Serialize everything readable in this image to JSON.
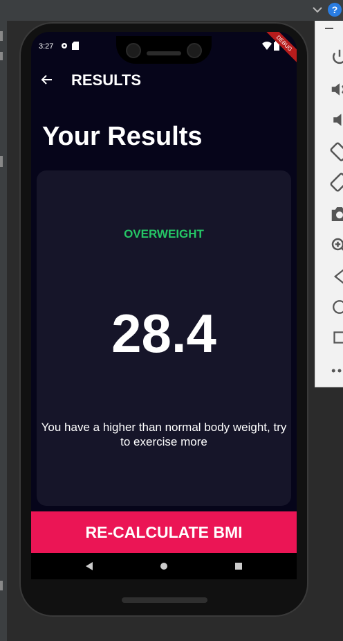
{
  "host": {
    "help_label": "?"
  },
  "emulator_toolbar": {
    "buttons": [
      "power-icon",
      "volume-up-icon",
      "volume-down-icon",
      "rotate-left-icon",
      "rotate-right-icon",
      "camera-icon",
      "zoom-icon",
      "back-triangle-icon",
      "home-circle-icon",
      "overview-square-icon",
      "more-icon"
    ]
  },
  "status_bar": {
    "time": "3:27",
    "debug_banner": "DEBUG"
  },
  "app_bar": {
    "title": "RESULTS"
  },
  "page": {
    "heading": "Your Results"
  },
  "result": {
    "status": "OVERWEIGHT",
    "status_color": "#25c766",
    "bmi": "28.4",
    "advice": "You have a higher than normal body weight, try to exercise more"
  },
  "button": {
    "recalculate_label": "RE-CALCULATE BMI",
    "color": "#eb1555"
  }
}
